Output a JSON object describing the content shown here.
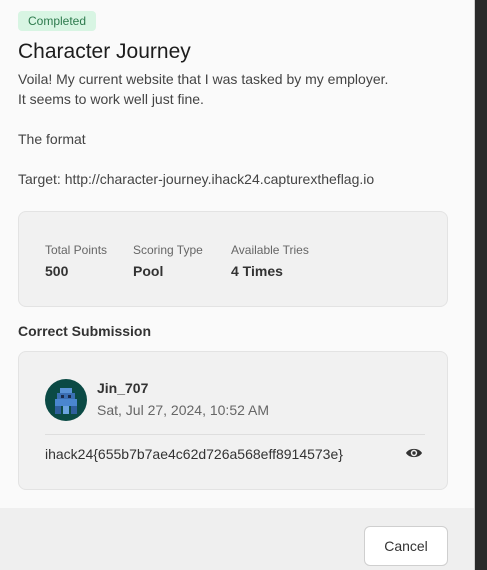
{
  "challenge": {
    "status_badge": "Completed",
    "title": "Character Journey",
    "description_lines": [
      "Voila! My current website that I was tasked by my employer.",
      "It seems to work well just fine."
    ],
    "format_line": "The format",
    "target_line": "Target: http://character-journey.ihack24.capturextheflag.io"
  },
  "stats": {
    "total_points": {
      "label": "Total Points",
      "value": "500"
    },
    "scoring_type": {
      "label": "Scoring Type",
      "value": "Pool"
    },
    "available_tries": {
      "label": "Available Tries",
      "value": "4 Times"
    }
  },
  "submission": {
    "section_title": "Correct Submission",
    "user": "Jin_707",
    "timestamp": "Sat, Jul 27, 2024, 10:52 AM",
    "flag": "ihack24{655b7b7ae4c62d726a568eff8914573e}"
  },
  "footer": {
    "cancel_label": "Cancel"
  },
  "icons": {
    "reveal": "eye-icon",
    "avatar": "pixel-avatar"
  },
  "colors": {
    "badge_bg": "#d8f5e3",
    "badge_text": "#2d7a4d",
    "avatar_bg": "#0b4a45"
  }
}
